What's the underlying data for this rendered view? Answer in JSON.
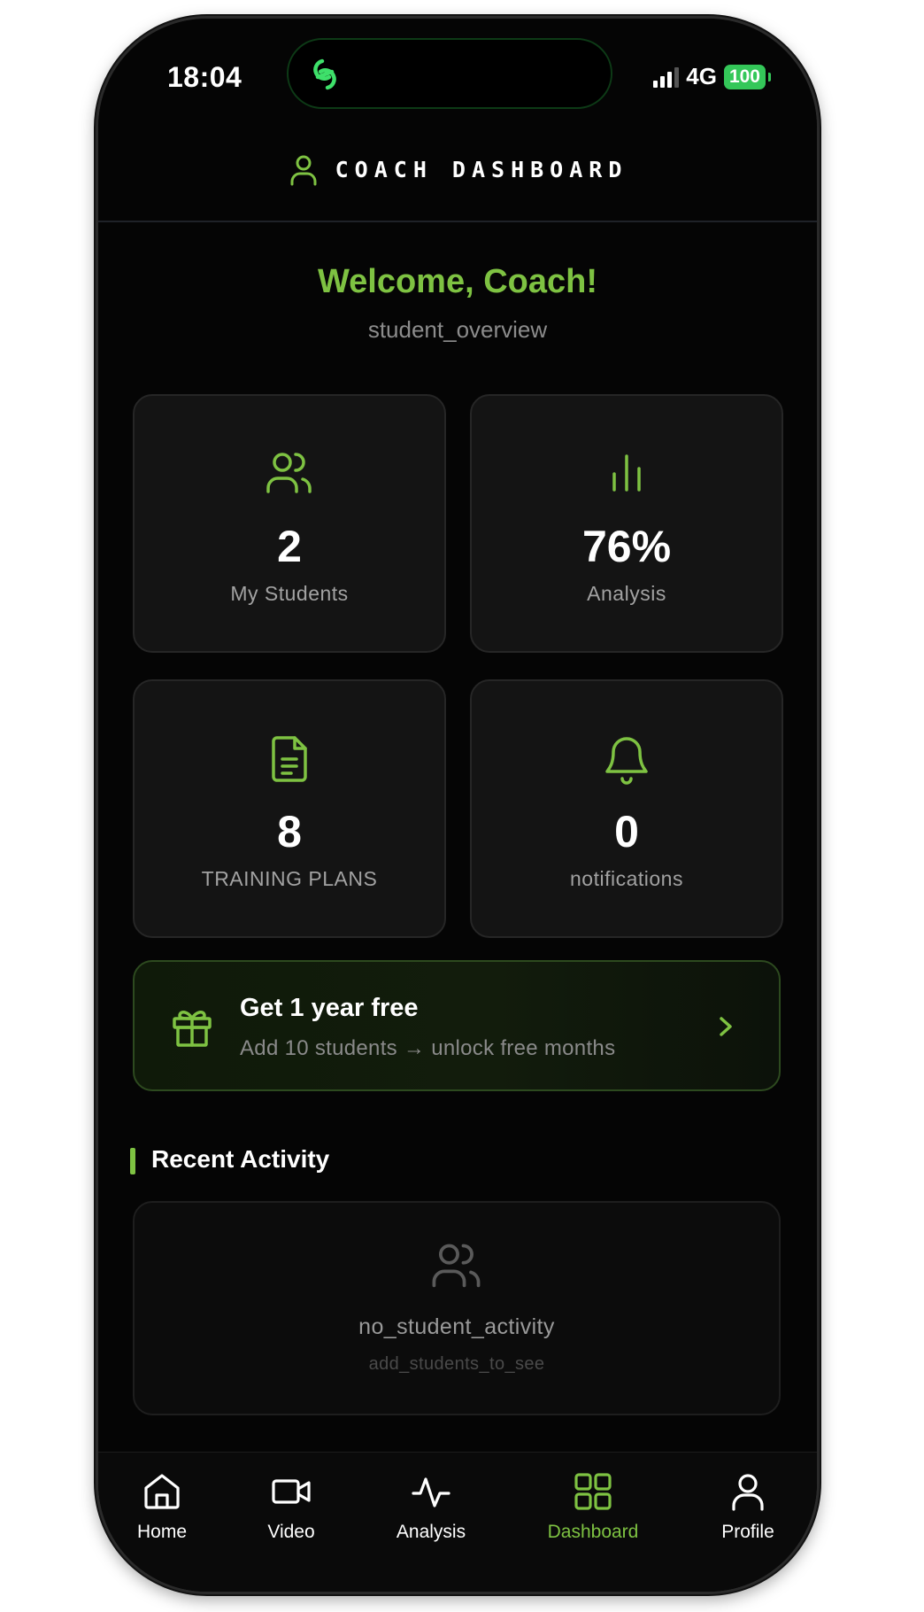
{
  "status_bar": {
    "time": "18:04",
    "network": "4G",
    "battery": "100"
  },
  "header": {
    "title": "COACH DASHBOARD"
  },
  "welcome": {
    "title": "Welcome, Coach!",
    "subtitle": "student_overview"
  },
  "stats": [
    {
      "value": "2",
      "label": "My Students",
      "icon": "users-icon"
    },
    {
      "value": "76%",
      "label": "Analysis",
      "icon": "bar-chart-icon"
    },
    {
      "value": "8",
      "label": "TRAINING PLANS",
      "icon": "document-icon"
    },
    {
      "value": "0",
      "label": "notifications",
      "icon": "bell-icon"
    }
  ],
  "promo": {
    "title": "Get 1 year free",
    "subtitle": "Add 10 students → unlock free months"
  },
  "recent_activity": {
    "title": "Recent Activity",
    "empty_title": "no_student_activity",
    "empty_subtitle": "add_students_to_see"
  },
  "nav": [
    {
      "label": "Home",
      "icon": "home-icon"
    },
    {
      "label": "Video",
      "icon": "video-camera-icon"
    },
    {
      "label": "Analysis",
      "icon": "activity-icon"
    },
    {
      "label": "Dashboard",
      "icon": "grid-icon",
      "active": true
    },
    {
      "label": "Profile",
      "icon": "user-icon"
    }
  ],
  "colors": {
    "accent": "#7ec242",
    "background": "#050505",
    "card": "#141414",
    "battery": "#34c759"
  }
}
